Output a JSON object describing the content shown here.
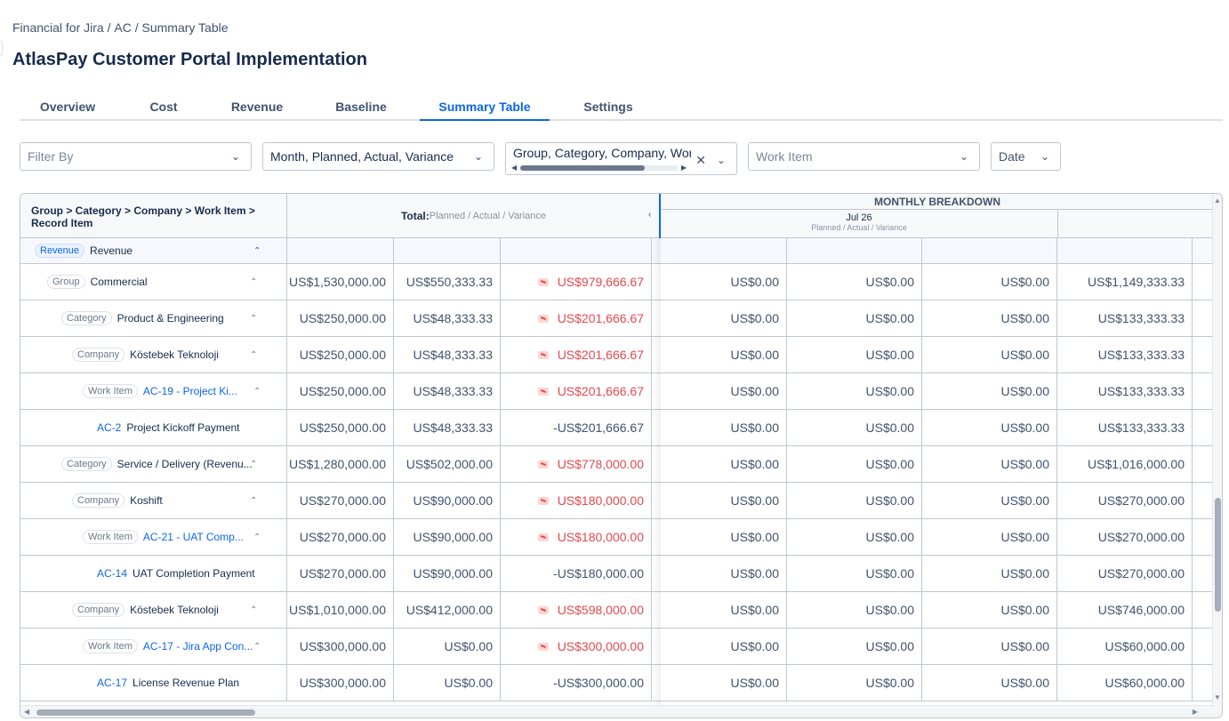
{
  "breadcrumb": {
    "app": "Financial for Jira",
    "sep1": " / ",
    "project": "AC",
    "sep2": " / ",
    "page": "Summary Table"
  },
  "page_title": "AtlasPay Customer Portal Implementation",
  "tabs": [
    "Overview",
    "Cost",
    "Revenue",
    "Baseline",
    "Summary Table",
    "Settings"
  ],
  "active_tab": "Summary Table",
  "filters": {
    "filter_by_placeholder": "Filter By",
    "columns_value": "Month, Planned, Actual, Variance",
    "grouping_value": "Group, Category, Company, Wor",
    "work_item_placeholder": "Work Item",
    "date_placeholder": "Date"
  },
  "table": {
    "hierarchy_header": "Group > Category > Company > Work Item > Record Item",
    "total_label": "Total:",
    "total_sub": "Planned / Actual / Variance",
    "monthly_breakdown": "MONTHLY BREAKDOWN",
    "month": "Jul 26",
    "month_sub": "Planned / Actual / Variance",
    "section_badge": "Revenue",
    "section_name": "Revenue",
    "rows": [
      {
        "badge": "Group",
        "name": "Commercial",
        "key": "",
        "planned": "US$1,530,000.00",
        "actual": "US$550,333.33",
        "variance": "US$979,666.67",
        "variance_alert": true,
        "m1": "US$0.00",
        "m2": "US$0.00",
        "m3": "US$0.00",
        "m4": "US$1,149,333.33"
      },
      {
        "badge": "Category",
        "name": "Product & Engineering",
        "key": "",
        "planned": "US$250,000.00",
        "actual": "US$48,333.33",
        "variance": "US$201,666.67",
        "variance_alert": true,
        "m1": "US$0.00",
        "m2": "US$0.00",
        "m3": "US$0.00",
        "m4": "US$133,333.33"
      },
      {
        "badge": "Company",
        "name": "Köstebek Teknoloji",
        "key": "",
        "planned": "US$250,000.00",
        "actual": "US$48,333.33",
        "variance": "US$201,666.67",
        "variance_alert": true,
        "m1": "US$0.00",
        "m2": "US$0.00",
        "m3": "US$0.00",
        "m4": "US$133,333.33"
      },
      {
        "badge": "Work Item",
        "name": "AC-19 - Project Ki...",
        "key": "",
        "planned": "US$250,000.00",
        "actual": "US$48,333.33",
        "variance": "US$201,666.67",
        "variance_alert": true,
        "m1": "US$0.00",
        "m2": "US$0.00",
        "m3": "US$0.00",
        "m4": "US$133,333.33"
      },
      {
        "badge": "",
        "name": "Project Kickoff Payment",
        "key": "AC-2",
        "planned": "US$250,000.00",
        "actual": "US$48,333.33",
        "variance": "-US$201,666.67",
        "variance_alert": false,
        "m1": "US$0.00",
        "m2": "US$0.00",
        "m3": "US$0.00",
        "m4": "US$133,333.33"
      },
      {
        "badge": "Category",
        "name": "Service / Delivery (Revenu...",
        "key": "",
        "planned": "US$1,280,000.00",
        "actual": "US$502,000.00",
        "variance": "US$778,000.00",
        "variance_alert": true,
        "m1": "US$0.00",
        "m2": "US$0.00",
        "m3": "US$0.00",
        "m4": "US$1,016,000.00"
      },
      {
        "badge": "Company",
        "name": "Koshift",
        "key": "",
        "planned": "US$270,000.00",
        "actual": "US$90,000.00",
        "variance": "US$180,000.00",
        "variance_alert": true,
        "m1": "US$0.00",
        "m2": "US$0.00",
        "m3": "US$0.00",
        "m4": "US$270,000.00"
      },
      {
        "badge": "Work Item",
        "name": "AC-21 - UAT Comp...",
        "key": "",
        "planned": "US$270,000.00",
        "actual": "US$90,000.00",
        "variance": "US$180,000.00",
        "variance_alert": true,
        "m1": "US$0.00",
        "m2": "US$0.00",
        "m3": "US$0.00",
        "m4": "US$270,000.00"
      },
      {
        "badge": "",
        "name": "UAT Completion Payment",
        "key": "AC-14",
        "planned": "US$270,000.00",
        "actual": "US$90,000.00",
        "variance": "-US$180,000.00",
        "variance_alert": false,
        "m1": "US$0.00",
        "m2": "US$0.00",
        "m3": "US$0.00",
        "m4": "US$270,000.00"
      },
      {
        "badge": "Company",
        "name": "Köstebek Teknoloji",
        "key": "",
        "planned": "US$1,010,000.00",
        "actual": "US$412,000.00",
        "variance": "US$598,000.00",
        "variance_alert": true,
        "m1": "US$0.00",
        "m2": "US$0.00",
        "m3": "US$0.00",
        "m4": "US$746,000.00"
      },
      {
        "badge": "Work Item",
        "name": "AC-17 - Jira App Con...",
        "key": "",
        "planned": "US$300,000.00",
        "actual": "US$0.00",
        "variance": "US$300,000.00",
        "variance_alert": true,
        "m1": "US$0.00",
        "m2": "US$0.00",
        "m3": "US$0.00",
        "m4": "US$60,000.00"
      },
      {
        "badge": "",
        "name": "License Revenue Plan",
        "key": "AC-17",
        "planned": "US$300,000.00",
        "actual": "US$0.00",
        "variance": "-US$300,000.00",
        "variance_alert": false,
        "m1": "US$0.00",
        "m2": "US$0.00",
        "m3": "US$0.00",
        "m4": "US$60,000.00"
      }
    ]
  },
  "colors": {
    "accent": "#0c66e4",
    "negative": "#e5484d",
    "border": "#c1c7d0"
  }
}
